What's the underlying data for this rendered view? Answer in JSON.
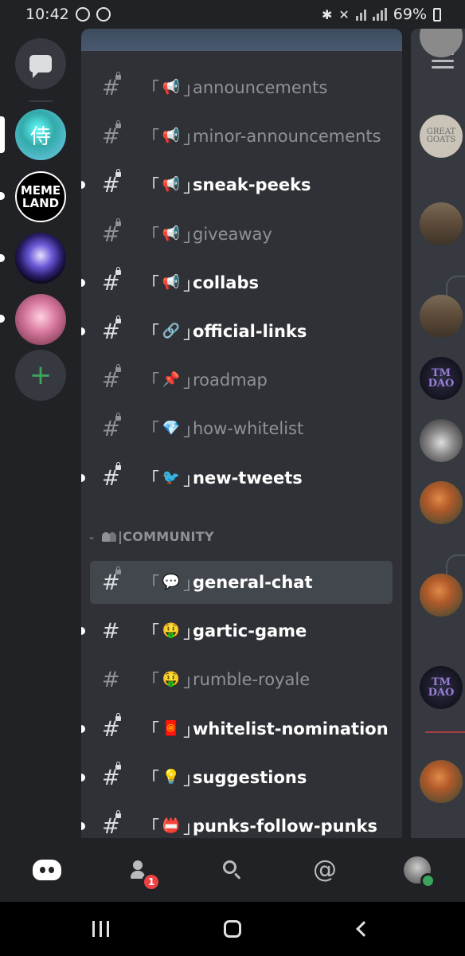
{
  "status_bar": {
    "time": "10:42",
    "battery": "69%"
  },
  "guilds": {
    "server1_glyph": "侍",
    "server2_line1": "MEME",
    "server2_line2": "LAND"
  },
  "channels": [
    {
      "name": "announcements",
      "emoji": "📢",
      "locked": true,
      "unread": false,
      "selected": false
    },
    {
      "name": "minor-announcements",
      "emoji": "📢",
      "locked": true,
      "unread": false,
      "selected": false
    },
    {
      "name": "sneak-peeks",
      "emoji": "📢",
      "locked": true,
      "unread": true,
      "selected": false
    },
    {
      "name": "giveaway",
      "emoji": "📢",
      "locked": true,
      "unread": false,
      "selected": false
    },
    {
      "name": "collabs",
      "emoji": "📢",
      "locked": true,
      "unread": true,
      "selected": false
    },
    {
      "name": "official-links",
      "emoji": "🔗",
      "locked": true,
      "unread": true,
      "selected": false
    },
    {
      "name": "roadmap",
      "emoji": "📌",
      "locked": true,
      "unread": false,
      "selected": false
    },
    {
      "name": "how-whitelist",
      "emoji": "💎",
      "locked": true,
      "unread": false,
      "selected": false
    },
    {
      "name": "new-tweets",
      "emoji": "🐦",
      "locked": true,
      "unread": true,
      "selected": false
    }
  ],
  "category": {
    "label": "|COMMUNITY"
  },
  "community_channels": [
    {
      "name": "general-chat",
      "emoji": "💬",
      "locked": true,
      "unread": false,
      "selected": true
    },
    {
      "name": "gartic-game",
      "emoji": "🤑",
      "locked": false,
      "unread": true,
      "selected": false
    },
    {
      "name": "rumble-royale",
      "emoji": "🤑",
      "locked": false,
      "unread": false,
      "selected": false
    },
    {
      "name": "whitelist-nomination",
      "emoji": "🧧",
      "locked": true,
      "unread": true,
      "selected": false
    },
    {
      "name": "suggestions",
      "emoji": "💡",
      "locked": true,
      "unread": true,
      "selected": false
    },
    {
      "name": "punks-follow-punks",
      "emoji": "📛",
      "locked": true,
      "unread": true,
      "selected": false
    }
  ],
  "bracket_open": "「",
  "bracket_close": "」",
  "members": {
    "goat_text": "GREAT GOATS",
    "tm_text": "TM DAO"
  },
  "bottom_nav": {
    "friends_badge": "1",
    "at_symbol": "@"
  },
  "colors": {
    "background": "#202225",
    "channel_bg": "#2f3136",
    "selected": "#42464d",
    "online": "#3ba55d",
    "badge": "#ed4245"
  }
}
